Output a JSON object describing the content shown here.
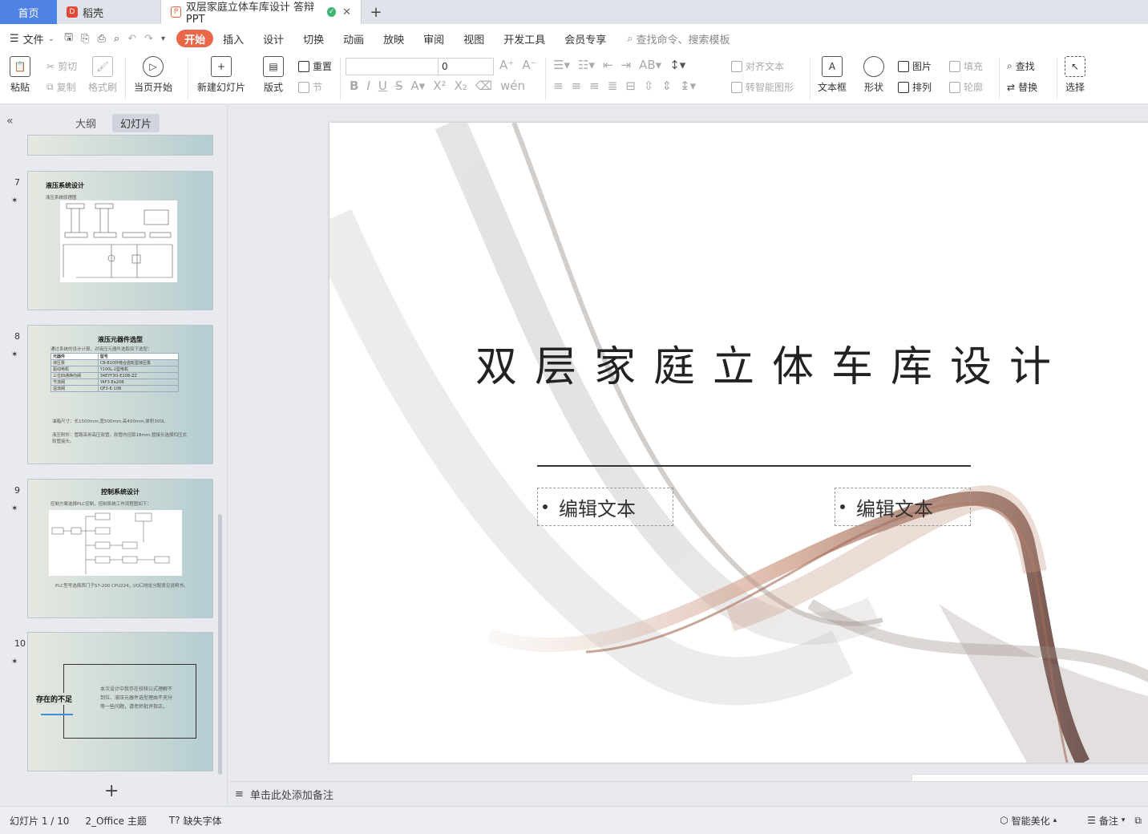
{
  "tabs": {
    "home": "首页",
    "daoke": "稻壳",
    "doc": "双层家庭立体车库设计 答辩PPT"
  },
  "menubar": {
    "file": "文件",
    "tabs": [
      "开始",
      "插入",
      "设计",
      "切换",
      "动画",
      "放映",
      "审阅",
      "视图",
      "开发工具",
      "会员专享"
    ],
    "search": "查找命令、搜索模板"
  },
  "ribbon": {
    "paste": "粘贴",
    "cut": "剪切",
    "copy": "复制",
    "format_brush": "格式刷",
    "from_current": "当页开始",
    "new_slide": "新建幻灯片",
    "layout": "版式",
    "reset": "重置",
    "section": "节",
    "font_size": "0",
    "align_text": "对齐文本",
    "smartart": "转智能图形",
    "textbox": "文本框",
    "shape": "形状",
    "picture": "图片",
    "arrange": "排列",
    "fill": "填充",
    "outline": "轮廓",
    "find": "查找",
    "replace": "替换",
    "select": "选择"
  },
  "leftpanel": {
    "tab_outline": "大纲",
    "tab_slides": "幻灯片",
    "thumbs": [
      {
        "num": "7",
        "title": "液压系统设计",
        "sub": "液压系统原理图"
      },
      {
        "num": "8",
        "title": "液压元器件选型",
        "sub": "通过系统的设计计算，对液压元器件选取如下选型：",
        "table": [
          [
            "元器件",
            "型号"
          ],
          [
            "液压泵",
            "CB-B10外啮合齿轮型液压泵"
          ],
          [
            "驱动电机",
            "Y100L-2型电机"
          ],
          [
            "三位四通换向阀",
            "34EYF3O-E20B-ZZ"
          ],
          [
            "节流阀",
            "YAF3-Ea20B"
          ],
          [
            "溢流阀",
            "QF3-E-10B"
          ]
        ],
        "note1": "油箱尺寸：长1500mm,宽500mm,高400mm,体积300L",
        "note2": "液压附件：管路采用高压软管，软管内径取18mm,管接头选择扣压式软管接头。"
      },
      {
        "num": "9",
        "title": "控制系统设计",
        "sub": "控制方案选择PLC控制，控制系统工作流程图如下：",
        "note": "PLC型号选择西门子S7-200 CPU224，I/O口地址分配表见说明书。"
      },
      {
        "num": "10",
        "title": "存在的不足",
        "body": "本次设计中我存在校核公式理解不到位、液压元器件选型理由不充分等一些问题，请老师批评指正。"
      }
    ]
  },
  "slide": {
    "title": "双层家庭立体车库设计",
    "placeholder_left": "编辑文本",
    "placeholder_right": "编辑文本"
  },
  "notes": {
    "placeholder": "单击此处添加备注"
  },
  "status": {
    "slide_counter": "幻灯片 1 / 10",
    "theme": "2_Office 主题",
    "missing_font": "缺失字体",
    "beautify": "智能美化",
    "notes": "备注"
  }
}
